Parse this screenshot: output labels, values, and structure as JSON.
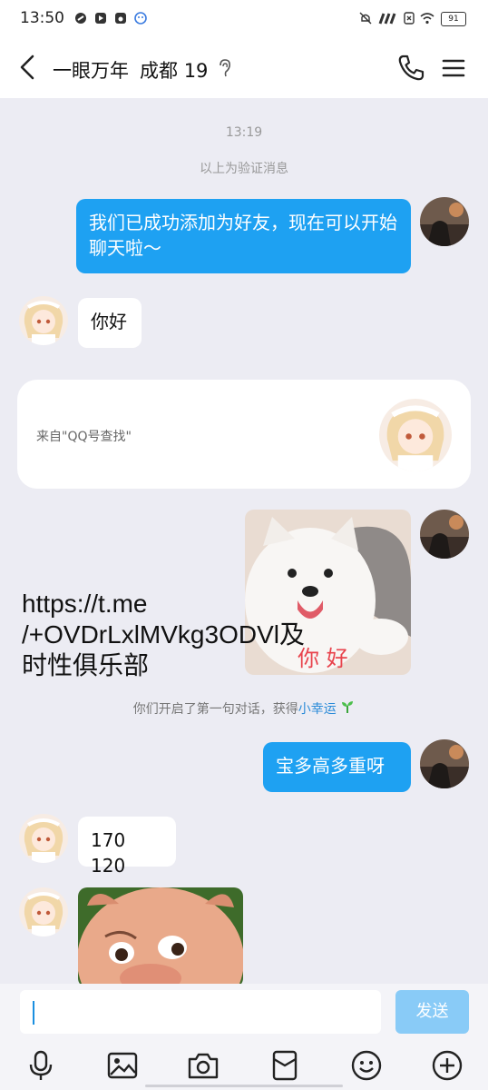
{
  "status_bar": {
    "time": "13:50",
    "battery": "91"
  },
  "header": {
    "contact_name": "一眼万年",
    "location": "成都",
    "age": "19"
  },
  "messages": {
    "time_stamp": "13:19",
    "verify_note": "以上为验证消息",
    "out_1": "我们已成功添加为好友，现在可以开始聊天啦～",
    "in_1": "你好",
    "card_source": "来自\"QQ号查找\"",
    "sticker_caption": "你 好",
    "overlay_link": "https://t.me\n/+OVDrLxlMVkg3ODVl及\n时性俱乐部",
    "luck_prefix": "你们开启了第一句对话，获得",
    "luck_link": "小幸运",
    "out_2": "宝多高多重呀",
    "in_2": "170 120"
  },
  "input": {
    "value": "",
    "send_label": "发送"
  },
  "toolbar": {
    "icons": [
      "microphone-icon",
      "image-icon",
      "camera-icon",
      "red-packet-icon",
      "emoji-icon",
      "plus-icon"
    ]
  },
  "colors": {
    "bubble_out": "#1ea1f2",
    "background": "#ececf3",
    "send_disabled": "#89cbf7",
    "link": "#2a8bd8"
  }
}
